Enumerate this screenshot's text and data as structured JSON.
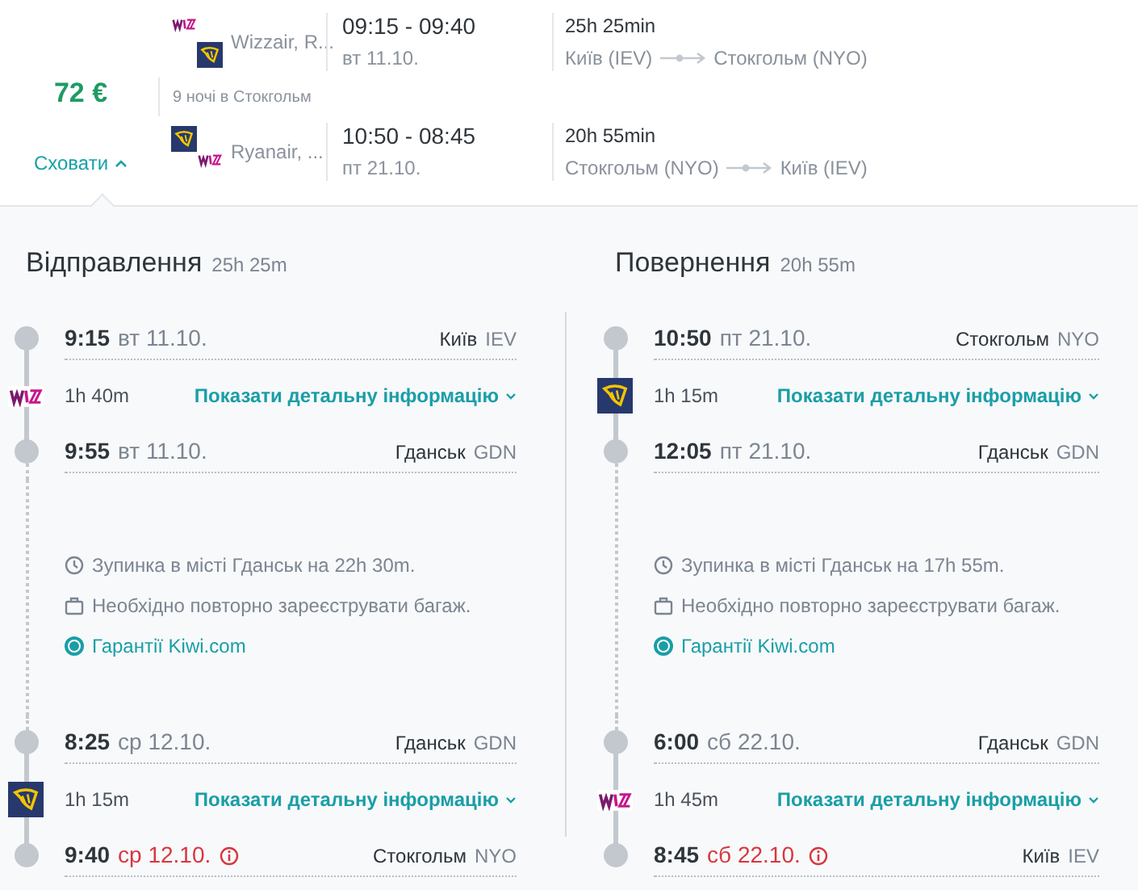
{
  "summary": {
    "price": "72 €",
    "toggle_label": "Сховати",
    "expanded": true,
    "nights": "9 ночі в Стокгольм",
    "legs": [
      {
        "logos": [
          {
            "kind": "wizz"
          },
          {
            "kind": "ryanair"
          }
        ],
        "airlines": "Wizzair, R...",
        "times": "09:15 - 09:40",
        "date": "вт 11.10.",
        "duration": "25h 25min",
        "from": "Київ (IEV)",
        "to": "Стокгольм (NYO)"
      },
      {
        "logos": [
          {
            "kind": "ryanair"
          },
          {
            "kind": "wizz"
          }
        ],
        "airlines": "Ryanair, ...",
        "times": "10:50 - 08:45",
        "date": "пт 21.10.",
        "duration": "20h 55min",
        "from": "Стокгольм (NYO)",
        "to": "Київ (IEV)"
      }
    ]
  },
  "directions": [
    {
      "title": "Відправлення",
      "duration": "25h 25m",
      "segments": [
        {
          "airline": {
            "kind": "wizz"
          },
          "departure": {
            "time": "9:15",
            "date": "вт 11.10.",
            "date_warning": false,
            "city": "Київ",
            "code": "IEV"
          },
          "flight_duration": "1h 40m",
          "details_link": "Показати детальну інформацію",
          "arrival": {
            "time": "9:55",
            "date": "вт 11.10.",
            "date_warning": false,
            "city": "Гданськ",
            "code": "GDN"
          }
        },
        {
          "airline": {
            "kind": "ryanair"
          },
          "departure": {
            "time": "8:25",
            "date": "ср 12.10.",
            "date_warning": false,
            "city": "Гданськ",
            "code": "GDN"
          },
          "flight_duration": "1h 15m",
          "details_link": "Показати детальну інформацію",
          "arrival": {
            "time": "9:40",
            "date": "ср 12.10.",
            "date_warning": true,
            "city": "Стокгольм",
            "code": "NYO"
          }
        }
      ],
      "layover": {
        "stop": "Зупинка в місті Гданськ на 22h 30m.",
        "baggage": "Необхідно повторно зареєструвати багаж.",
        "guarantee": "Гарантії Kiwi.com"
      }
    },
    {
      "title": "Повернення",
      "duration": "20h 55m",
      "segments": [
        {
          "airline": {
            "kind": "ryanair"
          },
          "departure": {
            "time": "10:50",
            "date": "пт 21.10.",
            "date_warning": false,
            "city": "Стокгольм",
            "code": "NYO"
          },
          "flight_duration": "1h 15m",
          "details_link": "Показати детальну інформацію",
          "arrival": {
            "time": "12:05",
            "date": "пт 21.10.",
            "date_warning": false,
            "city": "Гданськ",
            "code": "GDN"
          }
        },
        {
          "airline": {
            "kind": "wizz"
          },
          "departure": {
            "time": "6:00",
            "date": "сб 22.10.",
            "date_warning": false,
            "city": "Гданськ",
            "code": "GDN"
          },
          "flight_duration": "1h 45m",
          "details_link": "Показати детальну інформацію",
          "arrival": {
            "time": "8:45",
            "date": "сб 22.10.",
            "date_warning": true,
            "city": "Київ",
            "code": "IEV"
          }
        }
      ],
      "layover": {
        "stop": "Зупинка в місті Гданськ на 17h 55m.",
        "baggage": "Необхідно повторно зареєструвати багаж.",
        "guarantee": "Гарантії Kiwi.com"
      }
    }
  ]
}
